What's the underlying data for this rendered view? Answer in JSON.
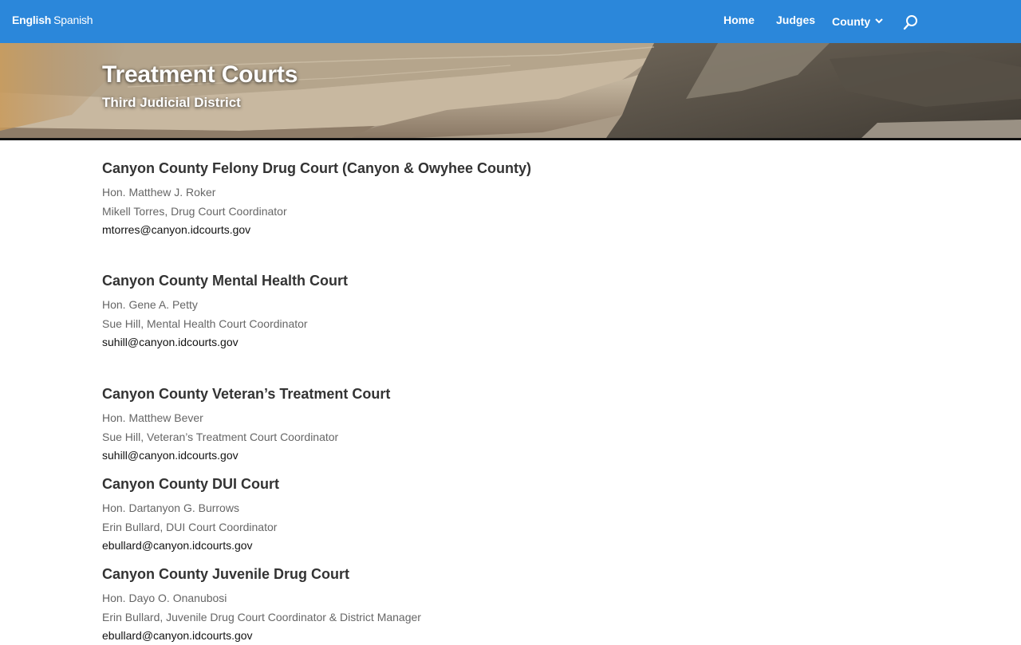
{
  "topbar": {
    "lang_english": "English",
    "lang_spanish": "Spanish",
    "nav": {
      "home": "Home",
      "judges": "Judges",
      "county": "County"
    },
    "colors": {
      "bar": "#2b87da",
      "text": "#ffffff"
    }
  },
  "hero": {
    "title": "Treatment Courts",
    "subtitle": "Third Judicial District"
  },
  "courts": [
    {
      "name": "Canyon County Felony Drug Court (Canyon & Owyhee County)",
      "judge": "Hon. Matthew J. Roker",
      "coordinator": "Mikell Torres, Drug Court Coordinator",
      "email": "mtorres@canyon.idcourts.gov"
    },
    {
      "name": "Canyon County Mental Health Court",
      "judge": "Hon. Gene A. Petty",
      "coordinator": "Sue Hill, Mental Health Court Coordinator",
      "email": "suhill@canyon.idcourts.gov"
    },
    {
      "name": "Canyon County Veteran’s Treatment Court",
      "judge": "Hon. Matthew Bever",
      "coordinator": "Sue Hill, Veteran’s Treatment Court Coordinator",
      "email": "suhill@canyon.idcourts.gov"
    },
    {
      "name": "Canyon County DUI Court",
      "judge": "Hon. Dartanyon G. Burrows",
      "coordinator": "Erin Bullard, DUI Court Coordinator",
      "email": "ebullard@canyon.idcourts.gov"
    },
    {
      "name": "Canyon County Juvenile Drug Court",
      "judge": "Hon. Dayo O. Onanubosi",
      "coordinator": "Erin Bullard, Juvenile Drug Court Coordinator & District Manager",
      "email": "ebullard@canyon.idcourts.gov"
    }
  ],
  "icons": {
    "search": "search-icon",
    "county_dropdown": "chevron-down-icon"
  }
}
